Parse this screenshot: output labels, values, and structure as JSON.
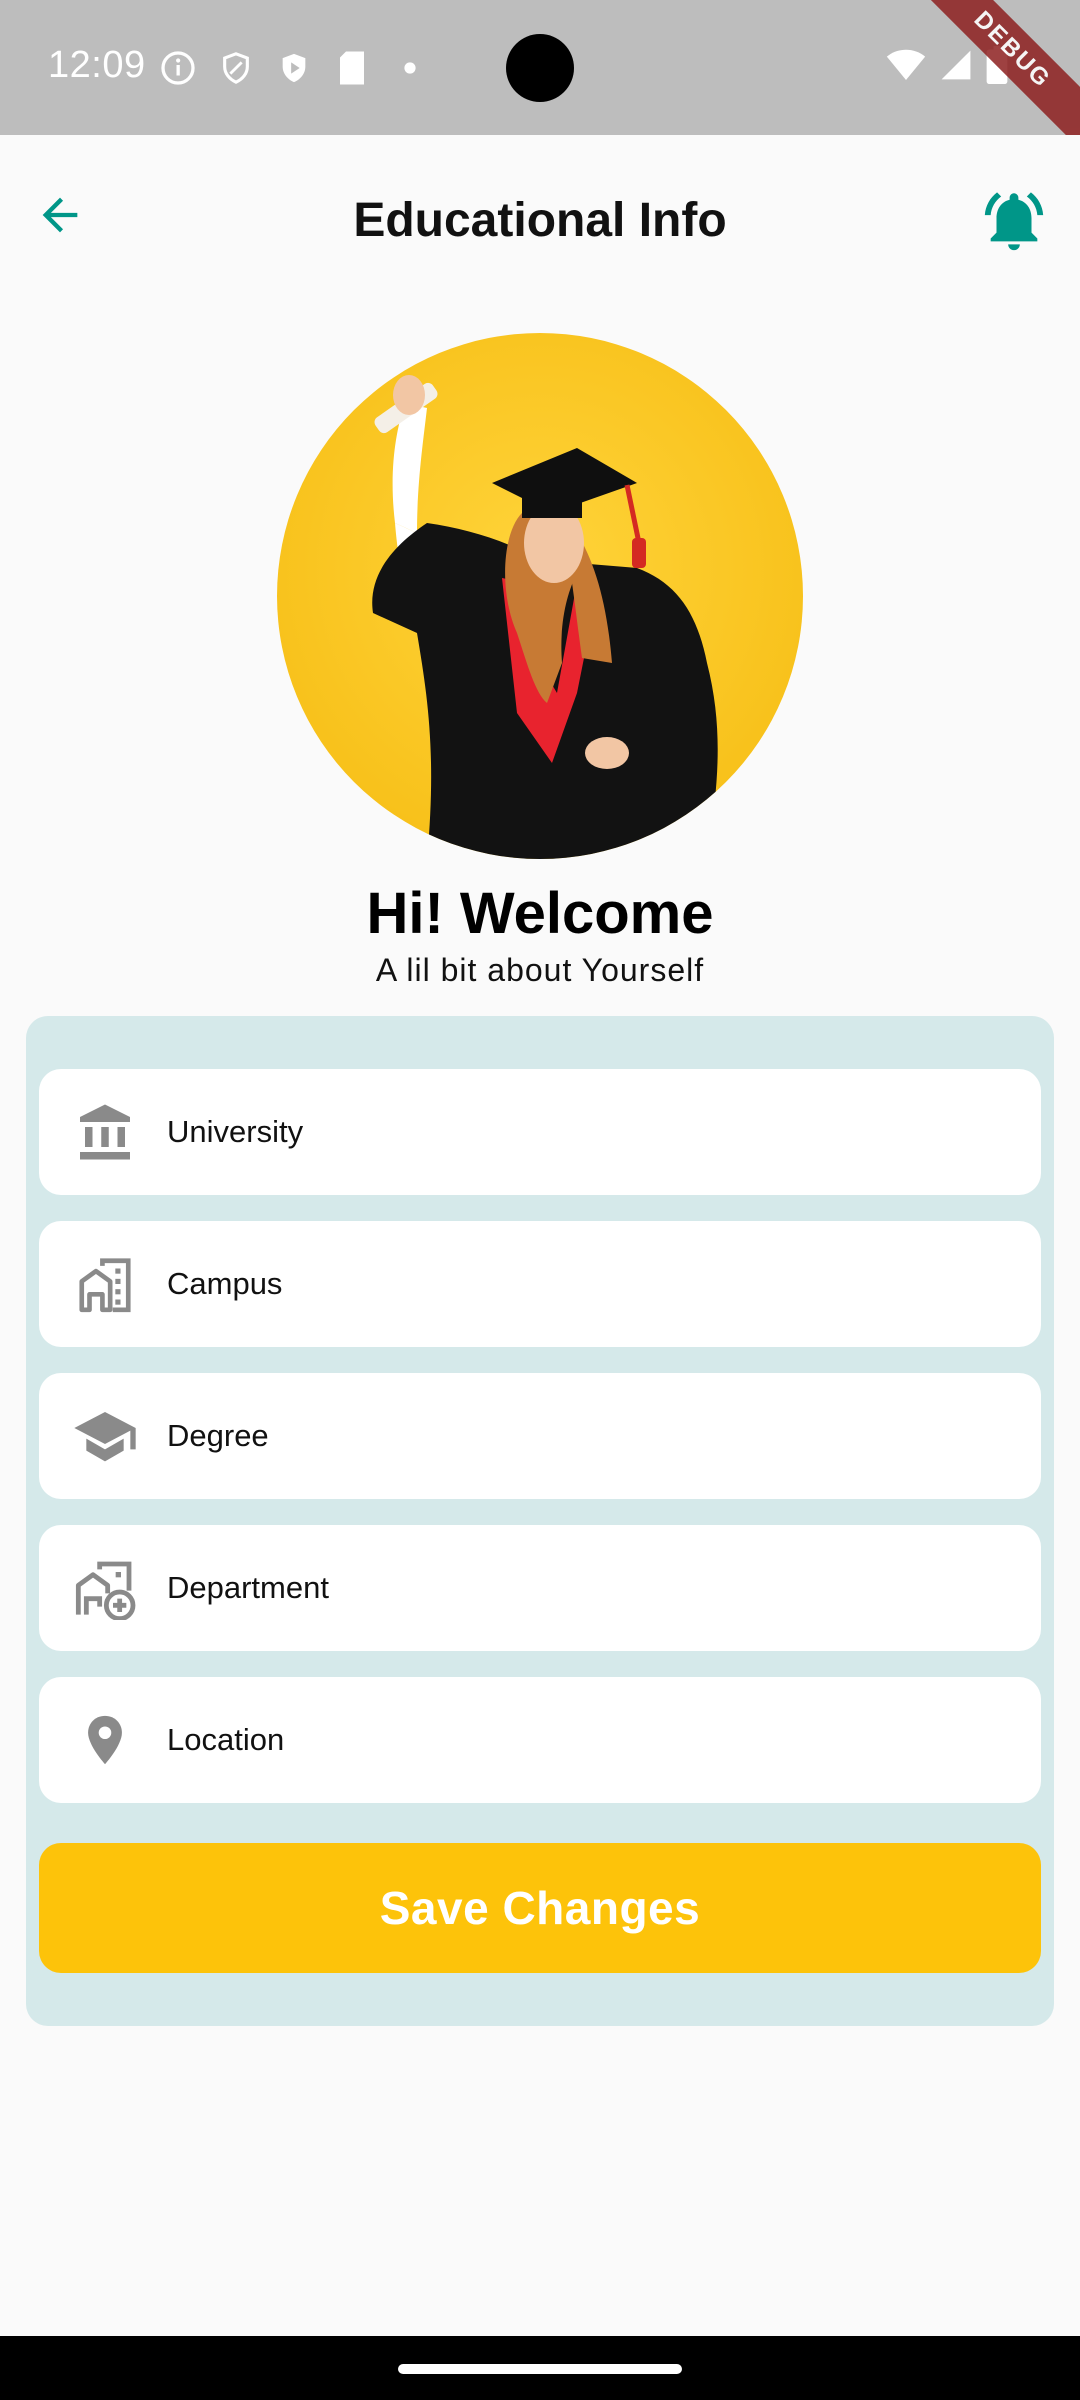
{
  "status_bar": {
    "time": "12:09",
    "debug_label": "DEBUG",
    "left_icons": [
      "info-icon",
      "shield-icon",
      "play-protect-icon",
      "sd-card-icon",
      "dot-icon"
    ],
    "right_icons": [
      "wifi-icon",
      "signal-icon",
      "battery-icon"
    ]
  },
  "app_bar": {
    "title": "Educational Info",
    "back_icon": "arrow-back-icon",
    "bell_icon": "notification-bell-icon"
  },
  "colors": {
    "accent": "#009688",
    "card_bg": "#d5e9ea",
    "button": "#fdc30a",
    "avatar_bg": "#f8c21c",
    "icon_gray": "#8a8a8a"
  },
  "profile": {
    "greeting": "Hi! Welcome",
    "subtitle": "A lil bit about Yourself"
  },
  "form": {
    "fields": [
      {
        "label": "University",
        "icon": "bank-icon"
      },
      {
        "label": "Campus",
        "icon": "buildings-icon"
      },
      {
        "label": "Degree",
        "icon": "school-icon"
      },
      {
        "label": "Department",
        "icon": "add-home-work-icon"
      },
      {
        "label": "Location",
        "icon": "location-pin-icon"
      }
    ],
    "save_label": "Save Changes"
  }
}
